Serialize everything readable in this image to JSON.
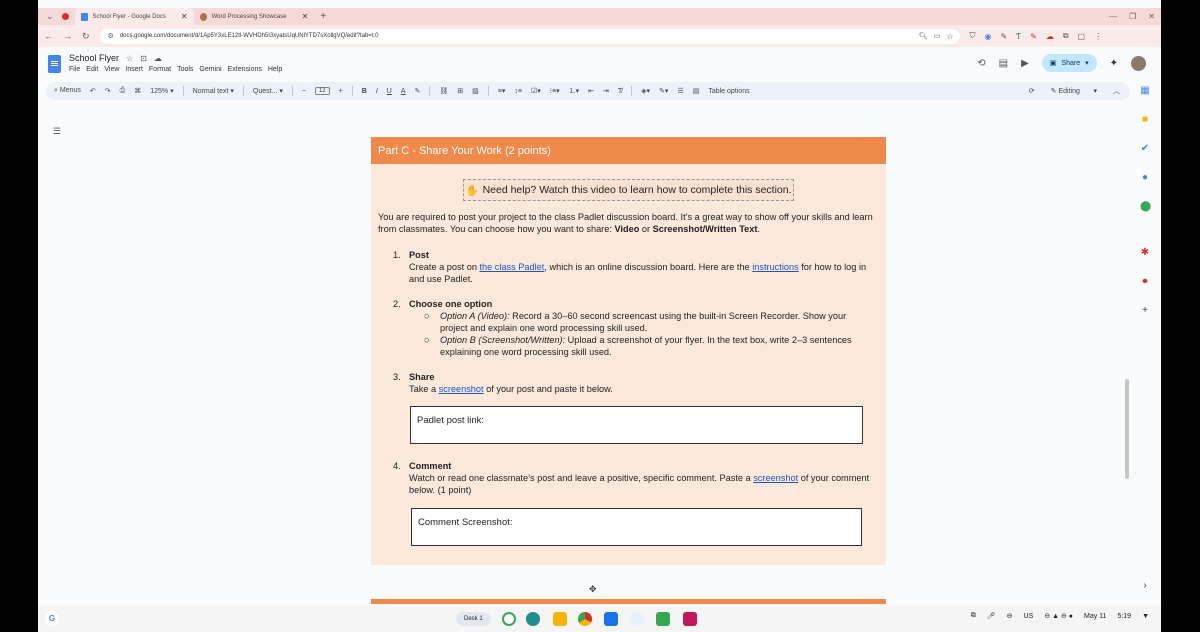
{
  "browser": {
    "tabs": [
      {
        "title": "School Flyer - Google Docs",
        "close": "✕"
      },
      {
        "title": "Word Processing Showcase",
        "close": "✕"
      }
    ],
    "new_tab": "+",
    "url": "docs.google.com/document/d/1Ap5Y3xLE12tl-WVHDh5I3xyatsUqUNlYTD7sXollgVQ/edit?tab=t.0"
  },
  "docs": {
    "title": "School Flyer",
    "menu": [
      "File",
      "Edit",
      "View",
      "Insert",
      "Format",
      "Tools",
      "Gemini",
      "Extensions",
      "Help"
    ],
    "share_label": "Share"
  },
  "toolbar": {
    "menus_label": "Menus",
    "zoom": "125%",
    "style": "Normal text",
    "font": "Quest...",
    "font_size": "12",
    "table_options": "Table options",
    "mode": "Editing"
  },
  "doc": {
    "header": "Part C - Share Your Work (2 points)",
    "help_text": "Need help? Watch this video to learn how to complete this section.",
    "intro_a": "You are required to post your project to the class Padlet discussion board. It’s a great way to show off your skills and learn from classmates. You can choose how you want to share: ",
    "intro_video": "Video",
    "intro_or": " or ",
    "intro_shot": "Screenshot/Written Text",
    "intro_end": ".",
    "s1_num": "1.",
    "s1_title": "Post",
    "s1_a": "Create a post on ",
    "s1_link1": "the class Padlet",
    "s1_b": ", which is an online discussion board. Here are the ",
    "s1_link2": "instructions",
    "s1_c": " for how to log in and use Padlet.",
    "s2_num": "2.",
    "s2_title": "Choose one option",
    "optA_label": "Option A (Video):",
    "optA_text": " Record a 30–60 second screencast using the built-in Screen Recorder. Show your project and explain one word processing skill used.",
    "optB_label": "Option B (Screenshot/Written):",
    "optB_text": " Upload a screenshot of your flyer. In the text box, write 2–3 sentences explaining one word processing skill used.",
    "s3_num": "3.",
    "s3_title": "Share",
    "s3_a": "Take a ",
    "s3_link": "screenshot",
    "s3_b": " of your post and paste it below.",
    "padlet_box": "Padlet post link:",
    "s4_num": "4.",
    "s4_title": "Comment",
    "s4_a": "Watch or read one classmate’s post and leave a positive, specific comment. Paste a ",
    "s4_link": "screenshot",
    "s4_b": " of your comment below. (1 point)",
    "comment_box": "Comment Screenshot:"
  },
  "shelf": {
    "desk": "Desk 1",
    "lang": "US",
    "date": "May 11",
    "time": "5:19"
  },
  "colors": {
    "header_orange": "#f08a4b",
    "page_peach": "#fde8dc",
    "link_blue": "#1a57c8"
  }
}
